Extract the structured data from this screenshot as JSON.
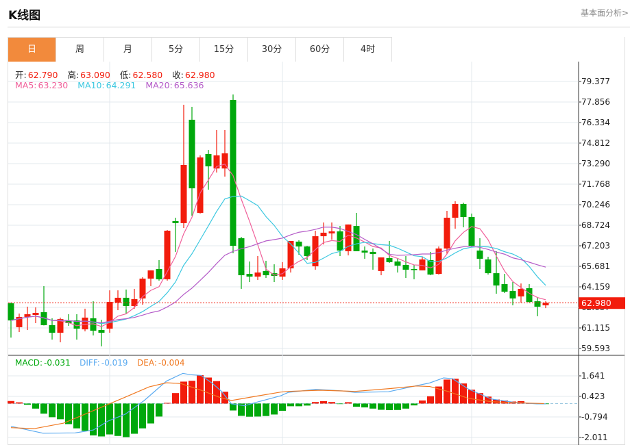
{
  "header": {
    "title": "K线图",
    "link": "基本面分析>"
  },
  "tabs": [
    {
      "label": "日",
      "active": true
    },
    {
      "label": "周"
    },
    {
      "label": "月"
    },
    {
      "label": "5分"
    },
    {
      "label": "15分"
    },
    {
      "label": "30分"
    },
    {
      "label": "60分"
    },
    {
      "label": "4时"
    }
  ],
  "ohlc_legend": {
    "open_label": "开:",
    "open": "62.790",
    "high_label": "高:",
    "high": "63.090",
    "low_label": "低:",
    "low": "62.580",
    "close_label": "收:",
    "close": "62.980"
  },
  "ma_legend": {
    "ma5_label": "MA5:",
    "ma5": "63.230",
    "ma10_label": "MA10:",
    "ma10": "64.291",
    "ma20_label": "MA20:",
    "ma20": "65.636"
  },
  "macd_legend": {
    "macd_label": "MACD:",
    "macd": "-0.031",
    "diff_label": "DIFF:",
    "diff": "-0.019",
    "dea_label": "DEA:",
    "dea": "-0.004"
  },
  "colors": {
    "up": "#f21c0c",
    "down": "#00a80c",
    "ma5": "#f0609a",
    "ma10": "#3cc8e0",
    "ma20": "#b45ac8",
    "diff": "#5aaaf0",
    "dea": "#f07820",
    "accent": "#f28a3c"
  },
  "chart_data": {
    "type": "candlestick",
    "price_axis": {
      "ticks": [
        "79.377",
        "77.856",
        "76.334",
        "74.812",
        "73.290",
        "71.768",
        "70.246",
        "68.724",
        "67.203",
        "65.681",
        "64.159",
        "62.637",
        "61.115",
        "59.593"
      ],
      "range": [
        59.593,
        79.377
      ]
    },
    "current_price": "62.980",
    "candles": [
      [
        62.94,
        61.67,
        63.0,
        60.4
      ],
      [
        61.17,
        61.93,
        62.18,
        60.81
      ],
      [
        61.93,
        62.13,
        62.69,
        60.96
      ],
      [
        62.08,
        62.23,
        62.64,
        61.47
      ],
      [
        62.28,
        61.32,
        64.21,
        61.3
      ],
      [
        61.32,
        60.76,
        61.83,
        60.25
      ],
      [
        60.76,
        61.77,
        61.88,
        60.05
      ],
      [
        61.67,
        61.47,
        62.13,
        61.27
      ],
      [
        61.67,
        61.06,
        62.13,
        60.25
      ],
      [
        61.01,
        61.88,
        62.54,
        60.86
      ],
      [
        61.83,
        60.91,
        63.09,
        60.56
      ],
      [
        60.96,
        60.76,
        61.72,
        59.75
      ],
      [
        61.06,
        63.04,
        63.9,
        60.76
      ],
      [
        62.99,
        63.35,
        63.9,
        62.43
      ],
      [
        63.35,
        62.74,
        63.96,
        62.18
      ],
      [
        62.74,
        63.25,
        64.01,
        62.54
      ],
      [
        63.3,
        64.77,
        64.87,
        62.84
      ],
      [
        64.77,
        65.38,
        65.38,
        64.21
      ],
      [
        65.48,
        64.72,
        66.14,
        64.62
      ],
      [
        64.72,
        68.32,
        68.37,
        64.62
      ],
      [
        69.03,
        68.88,
        69.28,
        66.75
      ],
      [
        68.88,
        73.19,
        77.65,
        68.52
      ],
      [
        76.54,
        71.46,
        77.5,
        69.43
      ],
      [
        69.64,
        73.75,
        73.9,
        69.59
      ],
      [
        74.0,
        73.09,
        74.3,
        71.36
      ],
      [
        72.93,
        73.9,
        75.78,
        72.63
      ],
      [
        72.93,
        74.05,
        75.78,
        72.33
      ],
      [
        78.01,
        67.2,
        78.41,
        66.65
      ],
      [
        67.76,
        65.02,
        67.86,
        64.01
      ],
      [
        65.12,
        64.92,
        66.04,
        64.51
      ],
      [
        64.92,
        65.22,
        66.44,
        64.67
      ],
      [
        65.33,
        65.02,
        66.09,
        64.82
      ],
      [
        65.17,
        64.97,
        65.83,
        64.51
      ],
      [
        64.92,
        65.53,
        65.99,
        64.67
      ],
      [
        65.53,
        67.56,
        67.56,
        65.22
      ],
      [
        67.51,
        67.15,
        67.61,
        66.54
      ],
      [
        67.15,
        66.44,
        67.2,
        66.14
      ],
      [
        65.68,
        67.91,
        68.32,
        65.43
      ],
      [
        67.91,
        68.17,
        68.93,
        67.3
      ],
      [
        68.12,
        68.27,
        68.93,
        67.66
      ],
      [
        68.27,
        66.85,
        68.67,
        66.44
      ],
      [
        66.8,
        68.78,
        68.78,
        66.49
      ],
      [
        68.67,
        66.8,
        69.64,
        66.8
      ],
      [
        66.85,
        66.7,
        67.15,
        66.24
      ],
      [
        66.75,
        66.59,
        67.0,
        65.43
      ],
      [
        65.33,
        66.34,
        66.34,
        65.02
      ],
      [
        66.29,
        65.99,
        67.56,
        65.93
      ],
      [
        66.04,
        65.73,
        66.24,
        65.22
      ],
      [
        65.78,
        65.43,
        66.44,
        64.82
      ],
      [
        65.48,
        65.43,
        65.78,
        64.72
      ],
      [
        65.38,
        66.19,
        66.39,
        65.38
      ],
      [
        66.14,
        65.07,
        66.75,
        65.02
      ],
      [
        65.12,
        67.0,
        67.15,
        65.07
      ],
      [
        67.0,
        69.28,
        69.79,
        66.59
      ],
      [
        69.28,
        70.3,
        70.5,
        68.47
      ],
      [
        70.3,
        69.33,
        70.4,
        68.57
      ],
      [
        69.33,
        67.2,
        69.59,
        67.1
      ],
      [
        66.85,
        66.24,
        67.76,
        65.48
      ],
      [
        66.19,
        65.17,
        66.39,
        65.07
      ],
      [
        65.17,
        64.26,
        66.8,
        63.65
      ],
      [
        64.36,
        63.8,
        65.12,
        63.7
      ],
      [
        63.85,
        63.3,
        64.51,
        62.79
      ],
      [
        63.45,
        64.01,
        64.41,
        62.99
      ],
      [
        64.06,
        63.04,
        64.36,
        62.99
      ],
      [
        63.09,
        62.69,
        63.4,
        61.98
      ],
      [
        62.79,
        62.98,
        63.09,
        62.58
      ]
    ],
    "macd_axis": {
      "ticks": [
        "1.641",
        "0.423",
        "-0.794",
        "-2.011"
      ],
      "range": [
        -2.011,
        1.641
      ]
    },
    "macd_hist": [
      0.15,
      0.07,
      -0.07,
      -0.3,
      -0.6,
      -0.81,
      -0.93,
      -1.22,
      -1.47,
      -1.62,
      -1.89,
      -1.95,
      -1.83,
      -1.92,
      -1.99,
      -1.79,
      -1.47,
      -1.18,
      -0.77,
      0.04,
      0.62,
      1.3,
      1.35,
      1.68,
      1.54,
      1.33,
      0.7,
      -0.41,
      -0.73,
      -0.78,
      -0.77,
      -0.74,
      -0.65,
      -0.43,
      -0.16,
      -0.16,
      -0.12,
      0.09,
      0.14,
      0.09,
      -0.01,
      0.08,
      -0.19,
      -0.23,
      -0.3,
      -0.37,
      -0.39,
      -0.38,
      -0.3,
      -0.11,
      0.18,
      0.43,
      1.01,
      1.42,
      1.47,
      1.19,
      0.82,
      0.62,
      0.41,
      0.24,
      0.18,
      0.12,
      0.14,
      0.02,
      0.01,
      -0.03
    ],
    "diff": [
      [
        0,
        -1.35
      ],
      [
        3.9,
        -1.76
      ],
      [
        7.8,
        -1.74
      ],
      [
        10,
        -1.57
      ],
      [
        11.8,
        -1.04
      ],
      [
        13.9,
        -0.63
      ],
      [
        16.2,
        0.18
      ],
      [
        18.9,
        1.33
      ],
      [
        20.9,
        1.79
      ],
      [
        21.8,
        1.71
      ],
      [
        23.1,
        1.67
      ],
      [
        24.5,
        1.19
      ],
      [
        25.6,
        0.72
      ],
      [
        26.8,
        -0.02
      ],
      [
        28.4,
        -0.13
      ],
      [
        30.1,
        0.11
      ],
      [
        32.8,
        0.46
      ],
      [
        33.7,
        0.66
      ],
      [
        37,
        0.84
      ],
      [
        40.3,
        0.75
      ],
      [
        41.8,
        0.66
      ],
      [
        45.9,
        0.7
      ],
      [
        49.3,
        1.06
      ],
      [
        50.9,
        1.22
      ],
      [
        52.6,
        1.52
      ],
      [
        53.7,
        1.47
      ],
      [
        55.6,
        0.86
      ],
      [
        58.4,
        0.27
      ],
      [
        61.2,
        0.07
      ],
      [
        63.9,
        -0.02
      ],
      [
        65,
        -0.019
      ]
    ],
    "dea": [
      [
        0,
        -1.43
      ],
      [
        2.8,
        -1.49
      ],
      [
        6.4,
        -1.16
      ],
      [
        10.6,
        -0.3
      ],
      [
        13.9,
        0.38
      ],
      [
        16.8,
        0.99
      ],
      [
        18.9,
        1.23
      ],
      [
        20.6,
        1.19
      ],
      [
        23.1,
        0.79
      ],
      [
        25.3,
        0.38
      ],
      [
        26.8,
        0.18
      ],
      [
        30.1,
        0.46
      ],
      [
        32.8,
        0.68
      ],
      [
        33.7,
        0.72
      ],
      [
        37.6,
        0.79
      ],
      [
        41.8,
        0.72
      ],
      [
        45.9,
        0.88
      ],
      [
        49.3,
        1.04
      ],
      [
        50.9,
        1.01
      ],
      [
        53.1,
        0.72
      ],
      [
        55.6,
        0.31
      ],
      [
        58.4,
        0.11
      ],
      [
        61.2,
        0.05
      ],
      [
        64.8,
        0.0
      ]
    ]
  }
}
